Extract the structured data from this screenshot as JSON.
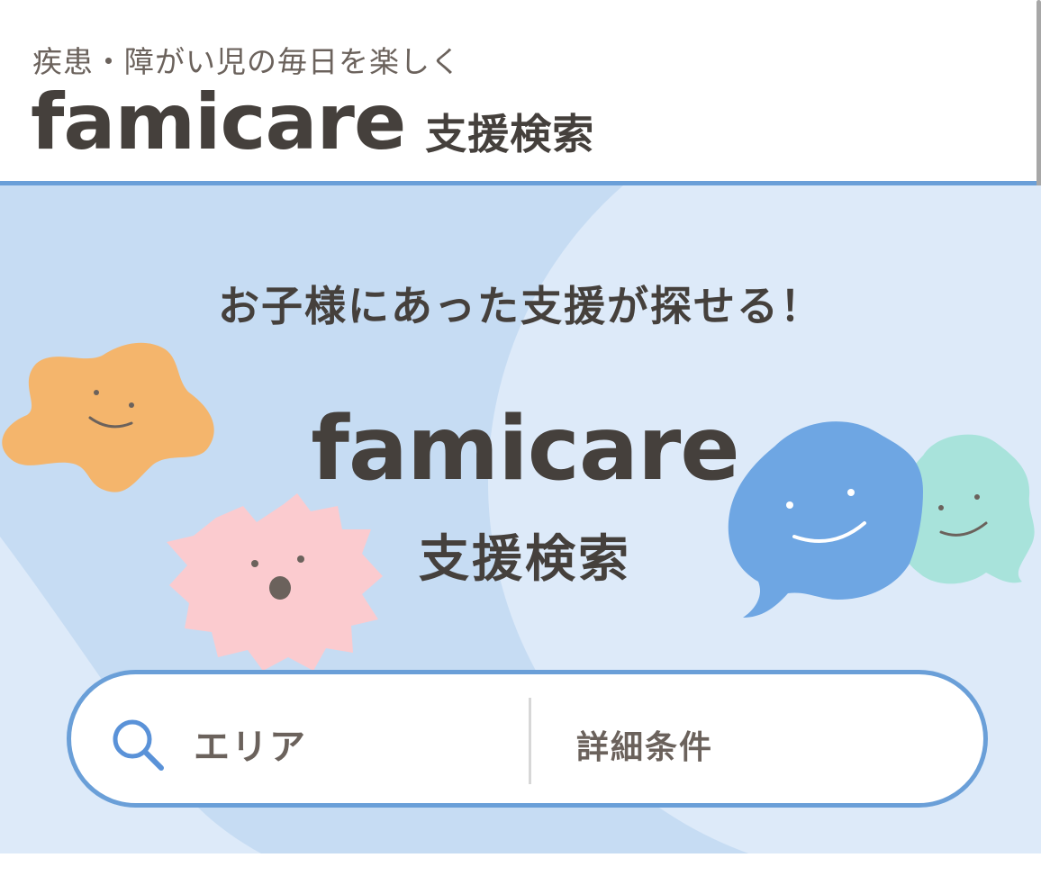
{
  "header": {
    "tagline": "疾患・障がい児の毎日を楽しく",
    "logo_word": "famicare",
    "logo_sub": "支援検索"
  },
  "hero": {
    "headline": "お子様にあった支援が探せる！",
    "logo_word": "famicare",
    "logo_sub": "支援検索"
  },
  "search": {
    "area_label": "エリア",
    "detail_label": "詳細条件"
  },
  "colors": {
    "accent": "#6a9fd8",
    "hero_bg": "#c6dcf3",
    "text": "#45403c",
    "orange_char": "#f4b56c",
    "pink_char": "#fbcbcf",
    "blue_char": "#6ea6e3",
    "mint_char": "#a8e3db"
  },
  "icons": [
    "search-icon"
  ]
}
